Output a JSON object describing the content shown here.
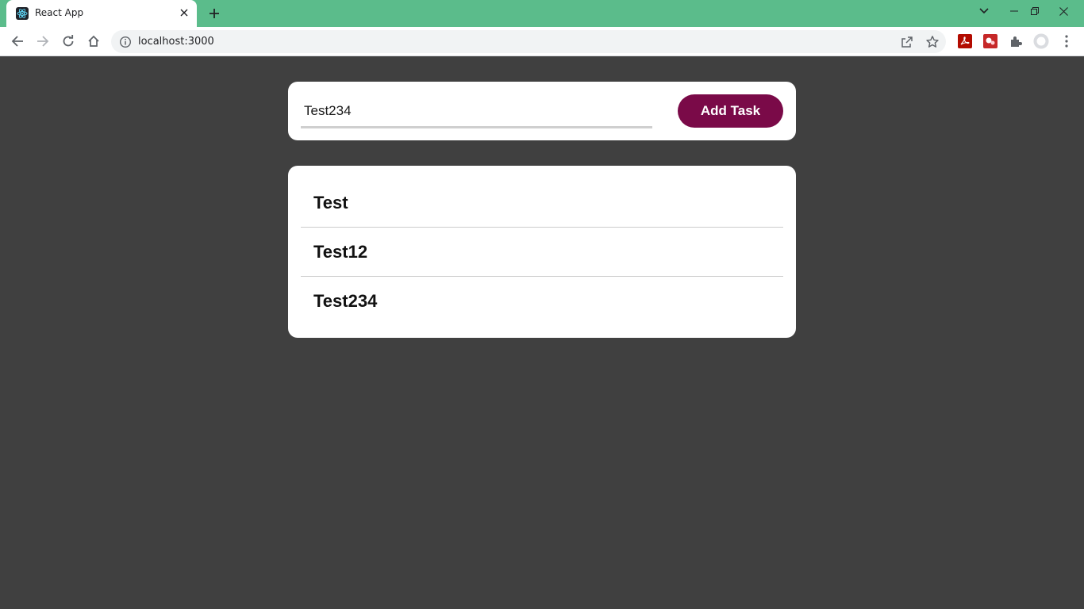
{
  "browser": {
    "tab_title": "React App",
    "url": "localhost:3000"
  },
  "app": {
    "input_value": "Test234",
    "add_button_label": "Add Task",
    "tasks": [
      "Test",
      "Test12",
      "Test234"
    ]
  },
  "colors": {
    "titlebar": "#5bbc8b",
    "page_background": "#404040",
    "accent_button": "#7a0a48"
  },
  "icons": {
    "back": "arrow-left-icon",
    "forward": "arrow-right-icon",
    "reload": "reload-icon",
    "home": "home-icon",
    "info": "info-icon",
    "share": "share-icon",
    "bookmark": "star-icon",
    "extensions": "puzzle-icon",
    "profile": "profile-icon",
    "menu": "kebab-menu-icon"
  }
}
